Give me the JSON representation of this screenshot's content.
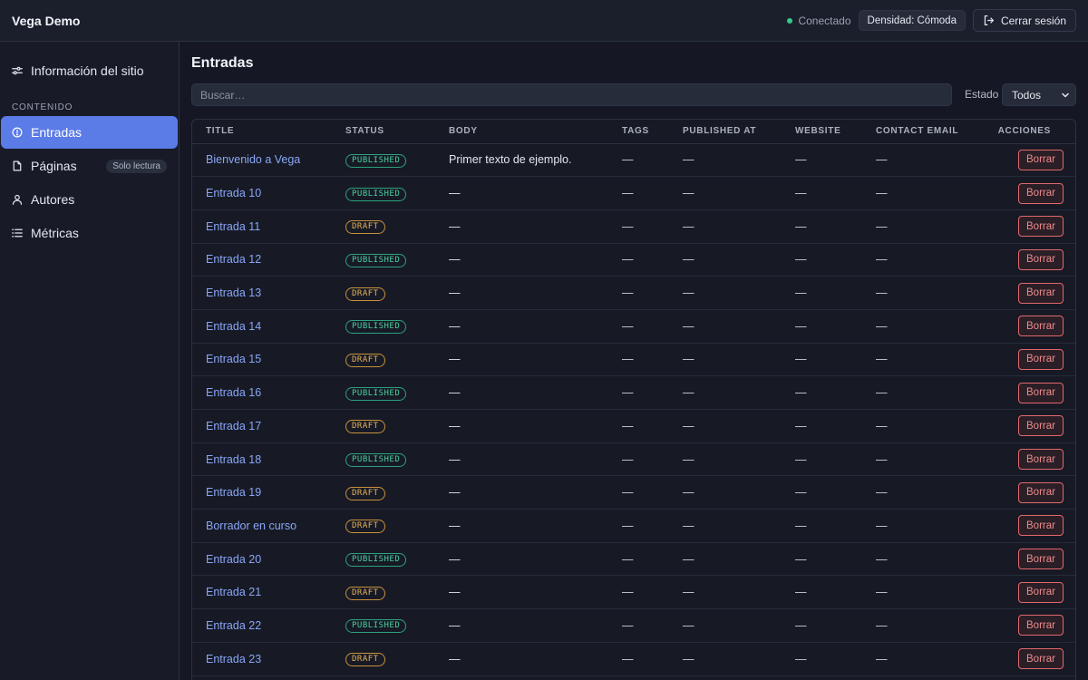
{
  "app": {
    "title": "Vega Demo"
  },
  "topbar": {
    "status": "Conectado",
    "status_color": "#34c98b",
    "density_label": "Densidad: Cómoda",
    "logout_label": "Cerrar sesión"
  },
  "sidebar": {
    "site_info": {
      "label": "Información del sitio",
      "icon": "sliders-icon"
    },
    "section_label": "CONTENIDO",
    "items": [
      {
        "label": "Entradas",
        "icon": "alert-circle-icon",
        "active": true
      },
      {
        "label": "Páginas",
        "icon": "file-icon",
        "badge": "Solo lectura"
      },
      {
        "label": "Autores",
        "icon": "user-icon"
      },
      {
        "label": "Métricas",
        "icon": "list-icon"
      }
    ]
  },
  "main": {
    "title": "Entradas",
    "search_placeholder": "Buscar…",
    "filter_label": "Estado",
    "filter_value": "Todos",
    "columns": [
      "TITLE",
      "STATUS",
      "BODY",
      "TAGS",
      "PUBLISHED AT",
      "WEBSITE",
      "CONTACT EMAIL",
      "ACCIONES"
    ],
    "empty": "—",
    "delete_label": "Borrar",
    "rows": [
      {
        "title": "Bienvenido a Vega",
        "status": "PUBLISHED",
        "body": "Primer texto de ejemplo."
      },
      {
        "title": "Entrada 10",
        "status": "PUBLISHED",
        "body": "—"
      },
      {
        "title": "Entrada 11",
        "status": "DRAFT",
        "body": "—"
      },
      {
        "title": "Entrada 12",
        "status": "PUBLISHED",
        "body": "—"
      },
      {
        "title": "Entrada 13",
        "status": "DRAFT",
        "body": "—"
      },
      {
        "title": "Entrada 14",
        "status": "PUBLISHED",
        "body": "—"
      },
      {
        "title": "Entrada 15",
        "status": "DRAFT",
        "body": "—"
      },
      {
        "title": "Entrada 16",
        "status": "PUBLISHED",
        "body": "—"
      },
      {
        "title": "Entrada 17",
        "status": "DRAFT",
        "body": "—"
      },
      {
        "title": "Entrada 18",
        "status": "PUBLISHED",
        "body": "—"
      },
      {
        "title": "Entrada 19",
        "status": "DRAFT",
        "body": "—"
      },
      {
        "title": "Borrador en curso",
        "status": "DRAFT",
        "body": "—"
      },
      {
        "title": "Entrada 20",
        "status": "PUBLISHED",
        "body": "—"
      },
      {
        "title": "Entrada 21",
        "status": "DRAFT",
        "body": "—"
      },
      {
        "title": "Entrada 22",
        "status": "PUBLISHED",
        "body": "—"
      },
      {
        "title": "Entrada 23",
        "status": "DRAFT",
        "body": "—"
      }
    ]
  },
  "colors": {
    "accent": "#5b7be6",
    "published": "#49d0a2",
    "draft": "#e8b25a",
    "danger": "#ef8a8d"
  }
}
